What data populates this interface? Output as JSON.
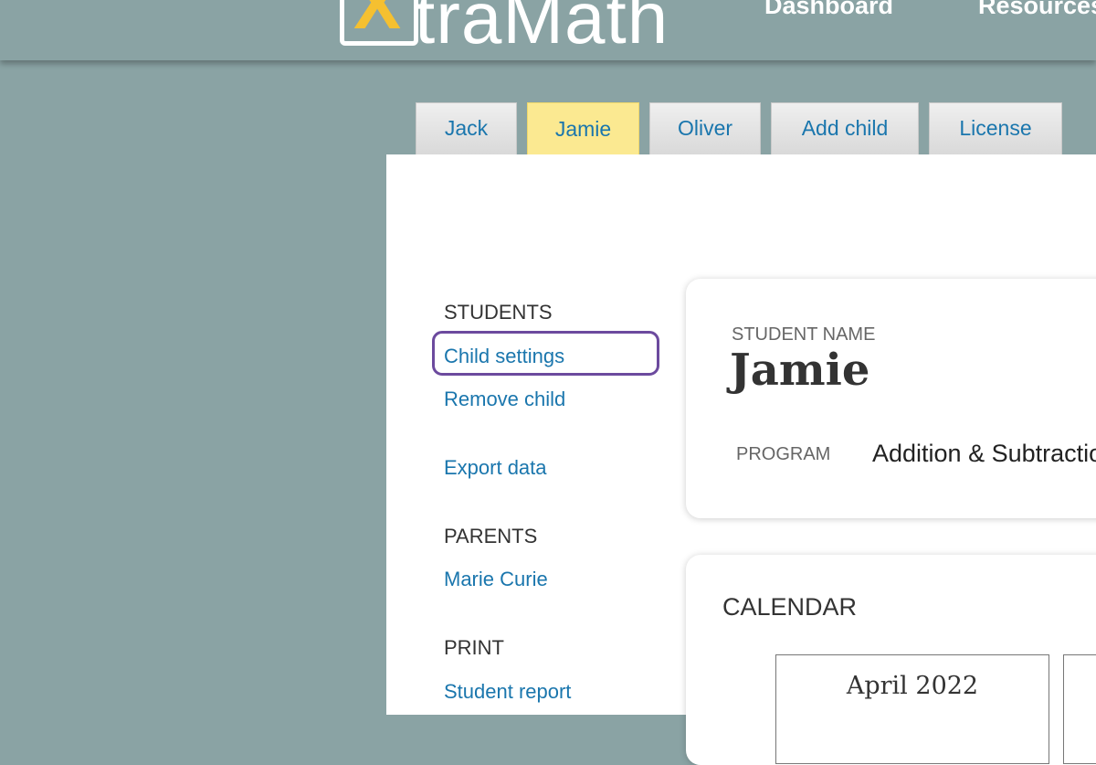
{
  "header": {
    "logo_text": "traMath",
    "logo_x": "X",
    "nav": [
      "Dashboard",
      "Resources"
    ]
  },
  "tabs": [
    {
      "label": "Jack",
      "active": false
    },
    {
      "label": "Jamie",
      "active": true
    },
    {
      "label": "Oliver",
      "active": false
    },
    {
      "label": "Add child",
      "active": false
    },
    {
      "label": "License",
      "active": false
    }
  ],
  "sidebar": {
    "students_heading": "STUDENTS",
    "child_settings": "Child settings",
    "remove_child": "Remove child",
    "export_data": "Export data",
    "parents_heading": "PARENTS",
    "parent_name": "Marie Curie",
    "print_heading": "PRINT",
    "student_report": "Student report"
  },
  "student_card": {
    "name_label": "STUDENT NAME",
    "name": "Jamie",
    "program_label": "PROGRAM",
    "program": "Addition & Subtraction"
  },
  "calendar": {
    "heading": "CALENDAR",
    "months": [
      "April 2022",
      ""
    ]
  },
  "colors": {
    "background": "#8aa3a4",
    "link": "#1a76ad",
    "active_tab": "#fbe991",
    "focus_ring": "#6c4a9e",
    "logo_accent": "#f5c030"
  }
}
